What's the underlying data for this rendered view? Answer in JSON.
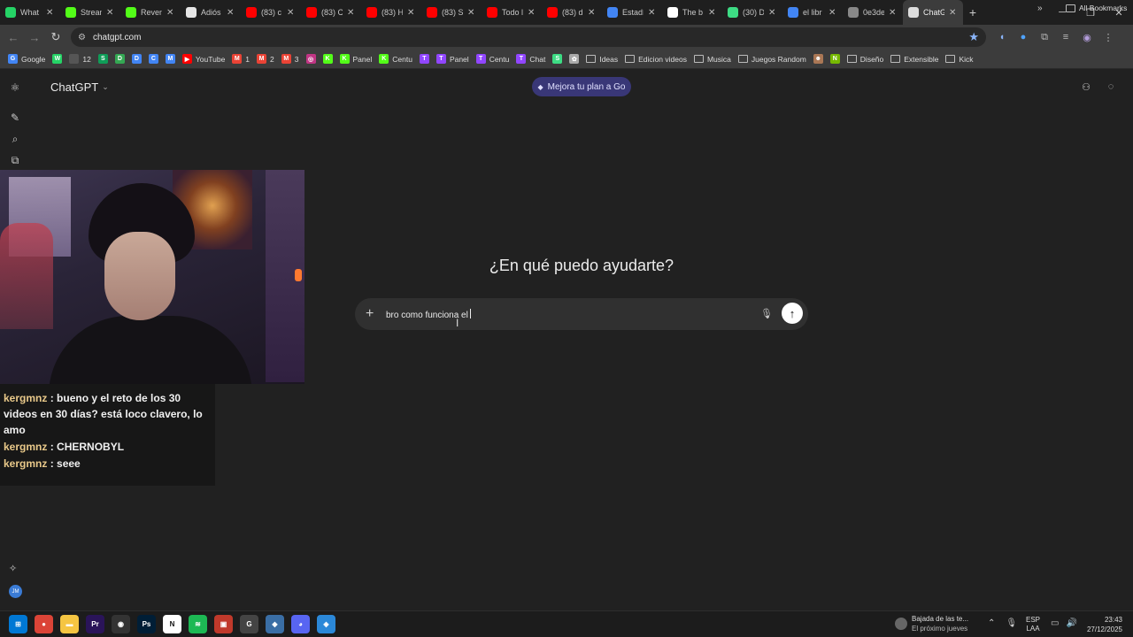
{
  "browser": {
    "tabs": [
      {
        "title": "What",
        "color": "#25d366",
        "icon": "whatsapp-icon"
      },
      {
        "title": "Stream",
        "color": "#53fc18",
        "icon": "kick-icon"
      },
      {
        "title": "Reven",
        "color": "#53fc18",
        "icon": "kick-icon"
      },
      {
        "title": "Adiós",
        "color": "#e6e6e6",
        "icon": "notion-icon"
      },
      {
        "title": "(83) c",
        "color": "#ff0000",
        "icon": "youtube-icon"
      },
      {
        "title": "(83) C",
        "color": "#ff0000",
        "icon": "youtube-icon"
      },
      {
        "title": "(83) H",
        "color": "#ff0000",
        "icon": "youtube-icon"
      },
      {
        "title": "(83) S",
        "color": "#ff0000",
        "icon": "youtube-icon"
      },
      {
        "title": "Todo l",
        "color": "#ff0000",
        "icon": "youtube-icon"
      },
      {
        "title": "(83) d",
        "color": "#ff0000",
        "icon": "youtube-icon"
      },
      {
        "title": "Estadí",
        "color": "#4285f4",
        "icon": "google-icon"
      },
      {
        "title": "The b",
        "color": "#ffffff",
        "icon": "github-icon"
      },
      {
        "title": "(30) D",
        "color": "#3ddc84",
        "icon": "app-icon"
      },
      {
        "title": "el libr",
        "color": "#4285f4",
        "icon": "google-icon"
      },
      {
        "title": "0e3de",
        "color": "#888888",
        "icon": "globe-icon"
      },
      {
        "title": "ChatG",
        "color": "#dddddd",
        "icon": "chatgpt-icon",
        "active": true
      }
    ],
    "url": "chatgpt.com",
    "bookmarks": [
      {
        "label": "Google",
        "kind": "icon",
        "color": "#4285f4",
        "glyph": "G"
      },
      {
        "label": "",
        "kind": "icon",
        "color": "#25d366",
        "glyph": "W"
      },
      {
        "label": "12",
        "kind": "icon",
        "color": "#555555",
        "glyph": ""
      },
      {
        "label": "",
        "kind": "icon",
        "color": "#0f9d58",
        "glyph": "S"
      },
      {
        "label": "",
        "kind": "icon",
        "color": "#34a853",
        "glyph": "D"
      },
      {
        "label": "",
        "kind": "icon",
        "color": "#4285f4",
        "glyph": "D"
      },
      {
        "label": "",
        "kind": "icon",
        "color": "#4285f4",
        "glyph": "C"
      },
      {
        "label": "",
        "kind": "icon",
        "color": "#4285f4",
        "glyph": "M"
      },
      {
        "label": "YouTube",
        "kind": "icon",
        "color": "#ff0000",
        "glyph": "▶"
      },
      {
        "label": "1",
        "kind": "icon",
        "color": "#ea4335",
        "glyph": "M"
      },
      {
        "label": "2",
        "kind": "icon",
        "color": "#ea4335",
        "glyph": "M"
      },
      {
        "label": "3",
        "kind": "icon",
        "color": "#ea4335",
        "glyph": "M"
      },
      {
        "label": "",
        "kind": "icon",
        "color": "#c13584",
        "glyph": "◎"
      },
      {
        "label": "",
        "kind": "icon",
        "color": "#53fc18",
        "glyph": "K"
      },
      {
        "label": "Panel",
        "kind": "icon",
        "color": "#53fc18",
        "glyph": "K"
      },
      {
        "label": "Centu",
        "kind": "icon",
        "color": "#53fc18",
        "glyph": "K"
      },
      {
        "label": "",
        "kind": "icon",
        "color": "#9146ff",
        "glyph": "T"
      },
      {
        "label": "Panel",
        "kind": "icon",
        "color": "#9146ff",
        "glyph": "T"
      },
      {
        "label": "Centu",
        "kind": "icon",
        "color": "#9146ff",
        "glyph": "T"
      },
      {
        "label": "Chat",
        "kind": "icon",
        "color": "#9146ff",
        "glyph": "T"
      },
      {
        "label": "",
        "kind": "icon",
        "color": "#3ddc84",
        "glyph": "S"
      },
      {
        "label": "",
        "kind": "icon",
        "color": "#aaaaaa",
        "glyph": "✿"
      },
      {
        "label": "Ideas",
        "kind": "folder"
      },
      {
        "label": "Edicion videos",
        "kind": "folder"
      },
      {
        "label": "Musica",
        "kind": "folder"
      },
      {
        "label": "Juegos Random",
        "kind": "folder"
      },
      {
        "label": "",
        "kind": "icon",
        "color": "#aa7755",
        "glyph": "☻"
      },
      {
        "label": "",
        "kind": "icon",
        "color": "#76b900",
        "glyph": "N"
      },
      {
        "label": "Diseño",
        "kind": "folder"
      },
      {
        "label": "Extensible",
        "kind": "folder"
      },
      {
        "label": "Kick",
        "kind": "folder"
      }
    ],
    "bookmarks_more": "»",
    "all_bookmarks": "All Bookmarks"
  },
  "chatgpt": {
    "model_label": "ChatGPT",
    "upgrade_label": "Mejora tu plan a Go",
    "heading": "¿En qué puedo ayudarte?",
    "composer_text": "bro como funciona el",
    "avatar_initials": "JM"
  },
  "stream_chat": [
    {
      "user": "kergmnz",
      "text": "bueno y el reto de los 30 videos en 30 días? está loco clavero, lo amo"
    },
    {
      "user": "kergmnz",
      "text": "CHERNOBYL"
    },
    {
      "user": "kergmnz",
      "text": "seee"
    }
  ],
  "taskbar": {
    "apps": [
      {
        "name": "windows-start-icon",
        "color": "#0078d4",
        "glyph": "⊞"
      },
      {
        "name": "chrome-icon",
        "color": "#db4437",
        "glyph": "●"
      },
      {
        "name": "file-explorer-icon",
        "color": "#f5c542",
        "glyph": "▬"
      },
      {
        "name": "premiere-icon",
        "color": "#2a1459",
        "glyph": "Pr"
      },
      {
        "name": "obs-icon",
        "color": "#333333",
        "glyph": "◉"
      },
      {
        "name": "photoshop-icon",
        "color": "#001e36",
        "glyph": "Ps"
      },
      {
        "name": "notion-icon",
        "color": "#ffffff",
        "glyph": "N"
      },
      {
        "name": "spotify-icon",
        "color": "#1db954",
        "glyph": "≋"
      },
      {
        "name": "streamer-app-icon",
        "color": "#c0392b",
        "glyph": "▣"
      },
      {
        "name": "app-g-icon",
        "color": "#444444",
        "glyph": "G"
      },
      {
        "name": "app-diamond-icon",
        "color": "#3a6ea5",
        "glyph": "◆"
      },
      {
        "name": "discord-icon",
        "color": "#5865f2",
        "glyph": "◕"
      },
      {
        "name": "app-photos-icon",
        "color": "#2b88d8",
        "glyph": "◈"
      }
    ],
    "news_title": "Bajada de las te...",
    "news_sub": "El próximo jueves",
    "lang_top": "ESP",
    "lang_bottom": "LAA",
    "time": "23:43",
    "date": "27/12/2025"
  }
}
